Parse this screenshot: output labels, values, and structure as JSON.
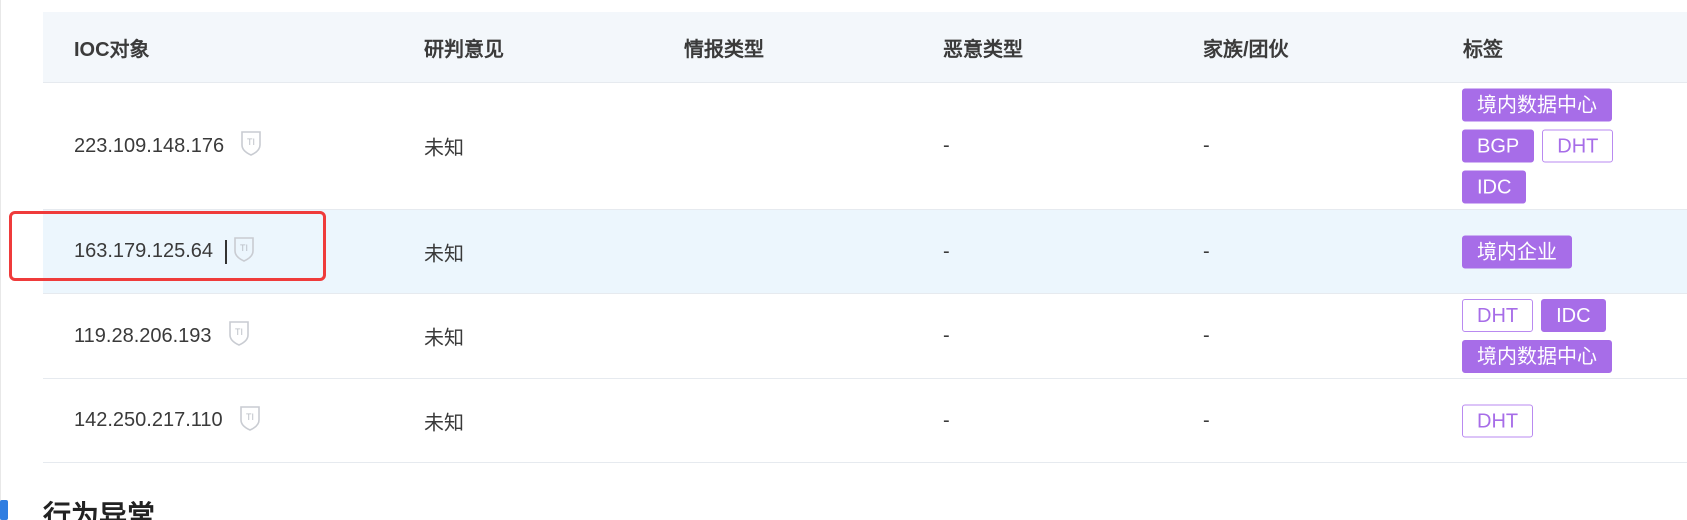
{
  "table": {
    "headers": {
      "ioc": "IOC对象",
      "verdict": "研判意见",
      "intel_type": "情报类型",
      "malicious_type": "恶意类型",
      "family": "家族/团伙",
      "tags": "标签"
    },
    "ti_badge": "TI",
    "rows": [
      {
        "ip": "223.109.148.176",
        "verdict": "未知",
        "intel_type": "",
        "malicious_type": "-",
        "family": "-",
        "tags": [
          {
            "label": "境内数据中心",
            "style": "filled"
          },
          {
            "label": "BGP",
            "style": "filled"
          },
          {
            "label": "DHT",
            "style": "outline"
          },
          {
            "label": "IDC",
            "style": "filled"
          }
        ]
      },
      {
        "ip": "163.179.125.64",
        "verdict": "未知",
        "intel_type": "",
        "malicious_type": "-",
        "family": "-",
        "tags": [
          {
            "label": "境内企业",
            "style": "filled"
          }
        ]
      },
      {
        "ip": "119.28.206.193",
        "verdict": "未知",
        "intel_type": "",
        "malicious_type": "-",
        "family": "-",
        "tags": [
          {
            "label": "DHT",
            "style": "outline"
          },
          {
            "label": "IDC",
            "style": "filled"
          },
          {
            "label": "境内数据中心",
            "style": "filled"
          }
        ]
      },
      {
        "ip": "142.250.217.110",
        "verdict": "未知",
        "intel_type": "",
        "malicious_type": "-",
        "family": "-",
        "tags": [
          {
            "label": "DHT",
            "style": "outline"
          }
        ]
      }
    ]
  },
  "section": {
    "title": "行为异常"
  },
  "colors": {
    "tag_purple": "#a76de8",
    "highlight_row": "#ecf6fd",
    "header_bg": "#f3f7fb",
    "selection_red": "#ef3b3b",
    "section_accent": "#2f7de1"
  }
}
